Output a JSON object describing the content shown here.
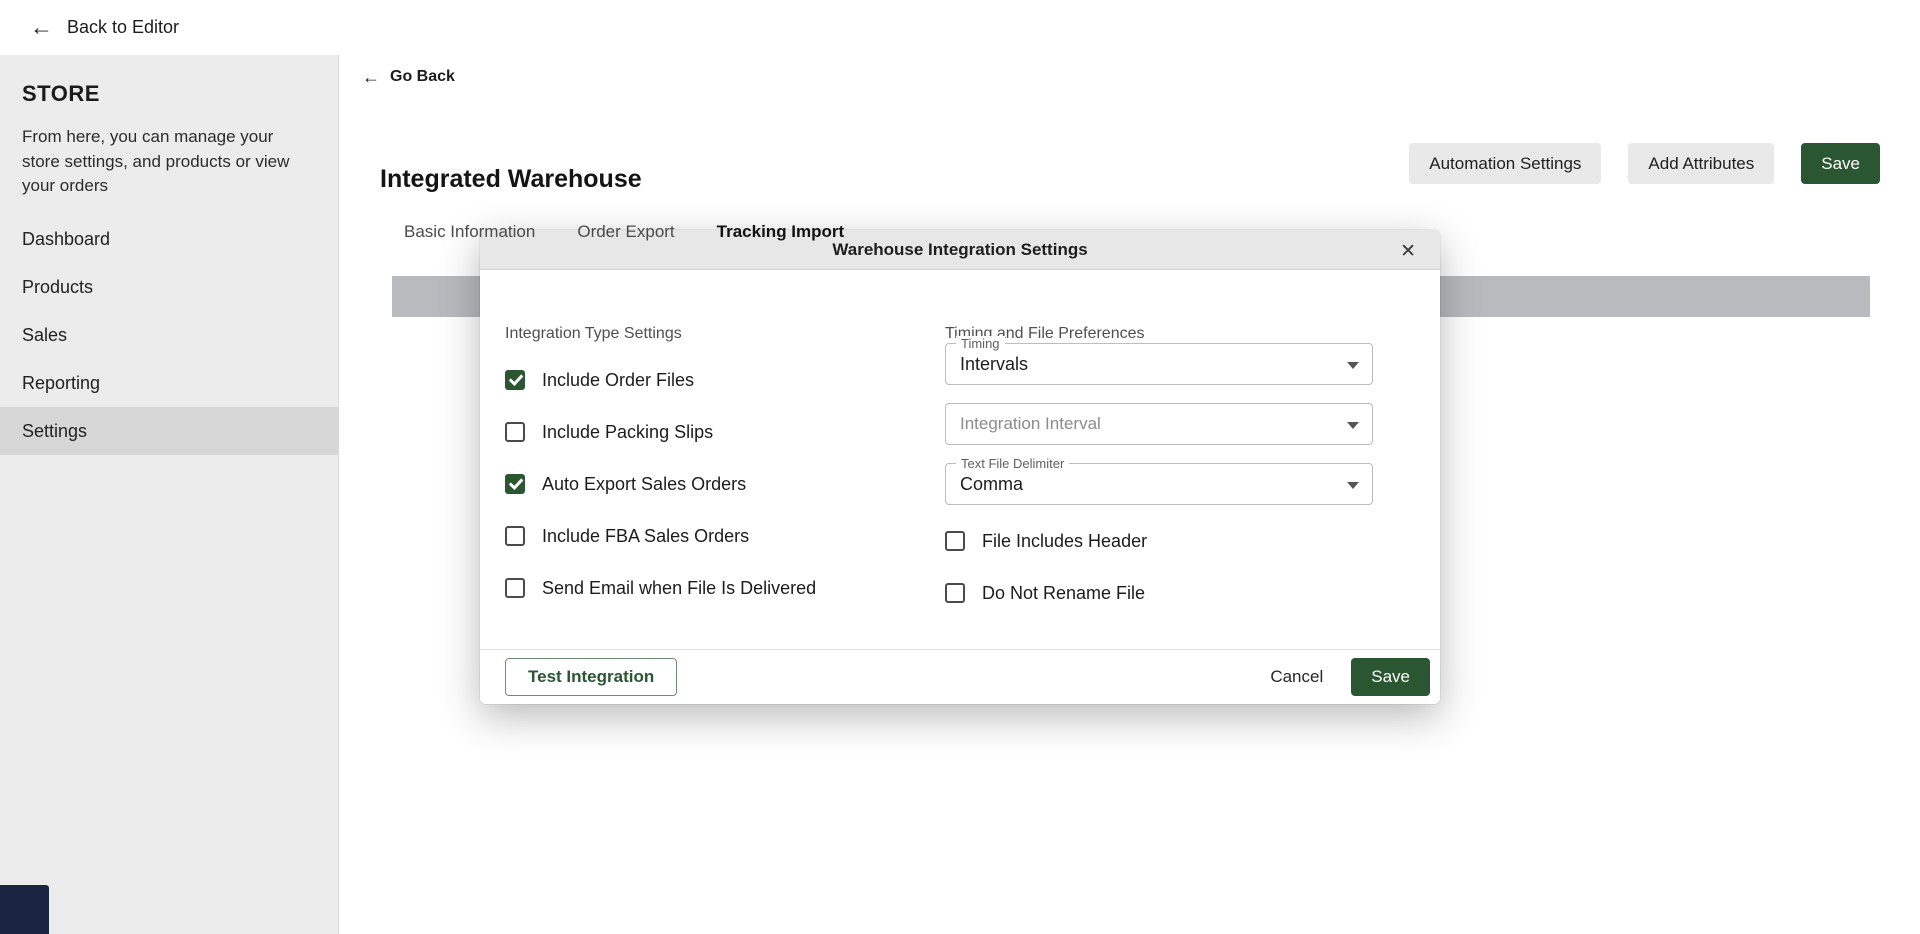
{
  "colors": {
    "accent": "#2a5632",
    "sidebar-bg": "#ececec",
    "sidebar-active": "#d7d7d7",
    "bar": "#b7bbbe",
    "modal-header": "#e7e7e7",
    "widget": "#1b2440"
  },
  "topbar": {
    "back_label": "Back to Editor",
    "back_arrow": "←"
  },
  "sidebar": {
    "title": "STORE",
    "description": "From here, you can manage your store settings, and products or view your orders",
    "items": [
      {
        "label": "Dashboard",
        "active": false
      },
      {
        "label": "Products",
        "active": false
      },
      {
        "label": "Sales",
        "active": false
      },
      {
        "label": "Reporting",
        "active": false
      },
      {
        "label": "Settings",
        "active": true
      }
    ]
  },
  "main": {
    "go_back": "Go Back",
    "go_back_arrow": "←",
    "title": "Integrated Warehouse",
    "actions": {
      "automation": "Automation Settings",
      "add_attributes": "Add Attributes",
      "save": "Save"
    },
    "tabs": [
      {
        "label": "Basic Information",
        "active": false
      },
      {
        "label": "Order Export",
        "active": false
      },
      {
        "label": "Tracking Import",
        "active": true
      }
    ]
  },
  "modal": {
    "title": "Warehouse Integration Settings",
    "close_glyph": "✕",
    "left": {
      "section": "Integration Type Settings",
      "checkboxes": [
        {
          "label": "Include Order Files",
          "checked": true
        },
        {
          "label": "Include Packing Slips",
          "checked": false
        },
        {
          "label": "Auto Export Sales Orders",
          "checked": true
        },
        {
          "label": "Include FBA Sales Orders",
          "checked": false
        },
        {
          "label": "Send Email when File Is Delivered",
          "checked": false
        }
      ],
      "test_button": "Test Integration"
    },
    "right": {
      "section": "Timing and File Preferences",
      "selects": [
        {
          "label": "Timing",
          "value": "Intervals",
          "empty": false
        },
        {
          "label": "Integration Interval",
          "value": "",
          "empty": true
        },
        {
          "label": "Text File Delimiter",
          "value": "Comma",
          "empty": false
        }
      ],
      "checkboxes": [
        {
          "label": "File Includes Header",
          "checked": false
        },
        {
          "label": "Do Not Rename File",
          "checked": false
        }
      ]
    },
    "footer": {
      "cancel": "Cancel",
      "save": "Save"
    }
  }
}
